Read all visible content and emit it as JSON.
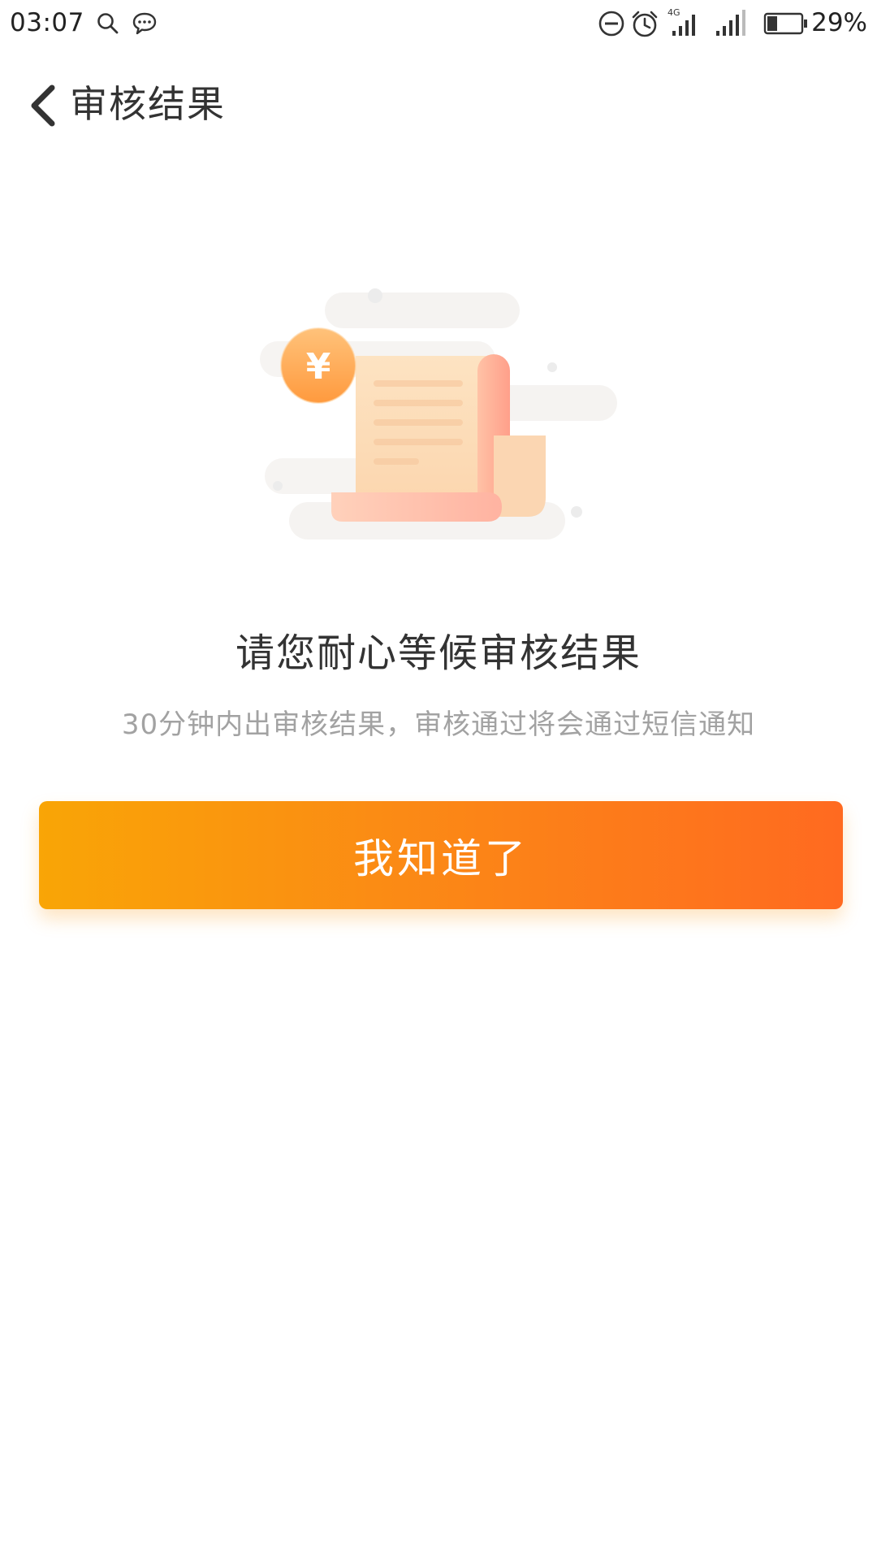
{
  "status_bar": {
    "time": "03:07",
    "network": "4G",
    "battery_percent": "29%",
    "battery_level": 0.29,
    "icons": [
      "search-icon",
      "chat-icon",
      "do-not-disturb-icon",
      "alarm-icon",
      "signal-4g-icon",
      "signal-icon",
      "battery-icon"
    ]
  },
  "header": {
    "back_icon": "chevron-left-icon",
    "title": "审核结果"
  },
  "illustration": {
    "coin_symbol": "¥",
    "icon": "receipt-scroll-icon"
  },
  "message": {
    "headline": "请您耐心等候审核结果",
    "detail": "30分钟内出审核结果，审核通过将会通过短信通知"
  },
  "actions": {
    "confirm_label": "我知道了"
  },
  "colors": {
    "button_gradient_start": "#f9a506",
    "button_gradient_end": "#ff6a20",
    "title_text": "#333333",
    "detail_text": "#a2a2a2"
  }
}
